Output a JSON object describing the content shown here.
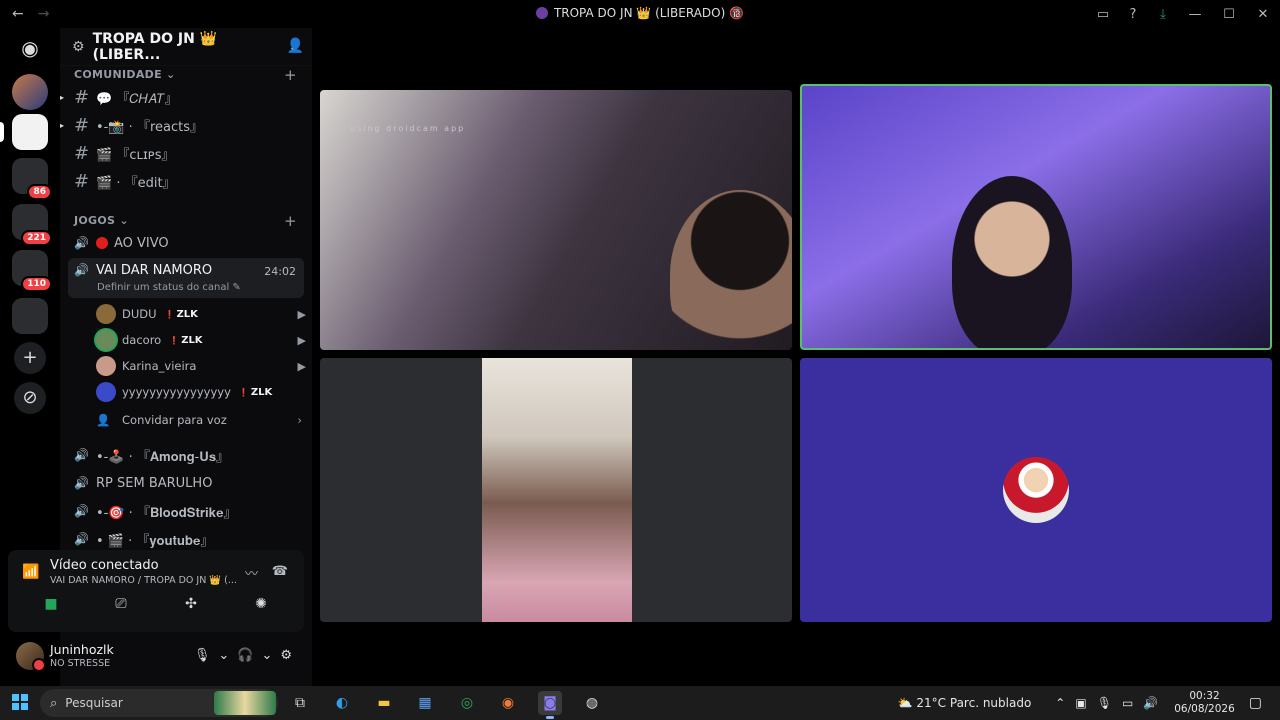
{
  "titlebar": {
    "back": "←",
    "forward": "→",
    "title": "TROPA DO JN 👑 (LIBERADO) 🔞",
    "icons": [
      "inbox-icon",
      "help-icon",
      "download-icon"
    ],
    "win_min": "—",
    "win_max": "☐",
    "win_close": "✕"
  },
  "guilds": {
    "badges": [
      "86",
      "221",
      "110"
    ],
    "add_server": "+",
    "discover": "⊘"
  },
  "sidebar": {
    "server_name": "TROPA DO JN 👑 (LIBER...",
    "categories": {
      "comunidade": "COMUNIDADE",
      "jogos": "JOGOS"
    },
    "text_channels": [
      {
        "label": "💬 『𝐶𝐻𝐴𝑇』"
      },
      {
        "label": "•-📸 · 『reacts』"
      },
      {
        "label": "🎬 『ᴄʟɪᴘs』"
      },
      {
        "label": "🎬 · 『edit』"
      }
    ],
    "voice_channels": {
      "ao_vivo": "AO VIVO",
      "active": "VAI DAR NAMORO",
      "active_timer": "24:02",
      "active_status": "Definir um status do canal ✎",
      "among_us": "•-🕹️ · 『𝐀𝐦𝐨𝐧𝐠-𝐔𝐬』",
      "rp": "RP SEM BARULHO",
      "bloodstrike": "•-🎯 · 『𝐁𝐥𝐨𝐨𝐝𝐒𝐭𝐫𝐢𝐤𝐞』",
      "youtube": "• 🎬 · 『𝐲𝐨𝐮𝐭𝐮𝐛𝐞』"
    },
    "voice_users": [
      {
        "name": "DUDU",
        "tag": "ZLK"
      },
      {
        "name": "dacoro",
        "tag": "ZLK"
      },
      {
        "name": "Karina_vieira",
        "tag": ""
      },
      {
        "name": "yyyyyyyyyyyyyyyy",
        "tag": "ZLK"
      }
    ],
    "invite": "Convidar para voz"
  },
  "rtc": {
    "status": "Vídeo conectado",
    "location": "VAI DAR NAMORO / TROPA DO JN 👑 (..."
  },
  "user": {
    "name": "Juninhozlk",
    "status": "NO STRESSE"
  },
  "stage": {
    "watermark": "using droidcam app"
  },
  "taskbar": {
    "search_placeholder": "Pesquisar",
    "weather": "21°C  Parc. nublado",
    "time": "00:32",
    "date": "06/08/2026"
  },
  "colors": {
    "accent_green": "#23a55a",
    "badge_red": "#f23f43",
    "speaking_border": "#5bbf70"
  }
}
